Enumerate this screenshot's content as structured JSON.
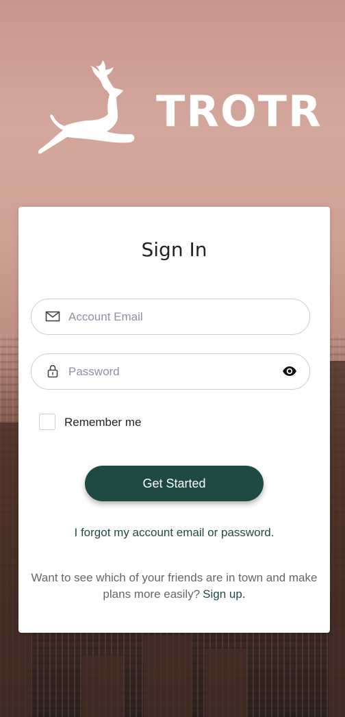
{
  "brand": {
    "name": "TROTR"
  },
  "signin": {
    "title": "Sign In",
    "email_placeholder": "Account Email",
    "password_placeholder": "Password",
    "remember_label": "Remember me",
    "remember_checked": false,
    "submit_label": "Get Started",
    "forgot_link": "I forgot my account email or password.",
    "signup_prompt": "Want to see which of your friends are in town and make plans more easily?",
    "signup_link": "Sign up."
  },
  "icons": {
    "logo": "deer-icon",
    "email": "envelope-icon",
    "password": "lock-icon",
    "visibility": "eye-icon"
  },
  "colors": {
    "accent": "#1f4a44",
    "placeholder": "#8a93a6"
  }
}
